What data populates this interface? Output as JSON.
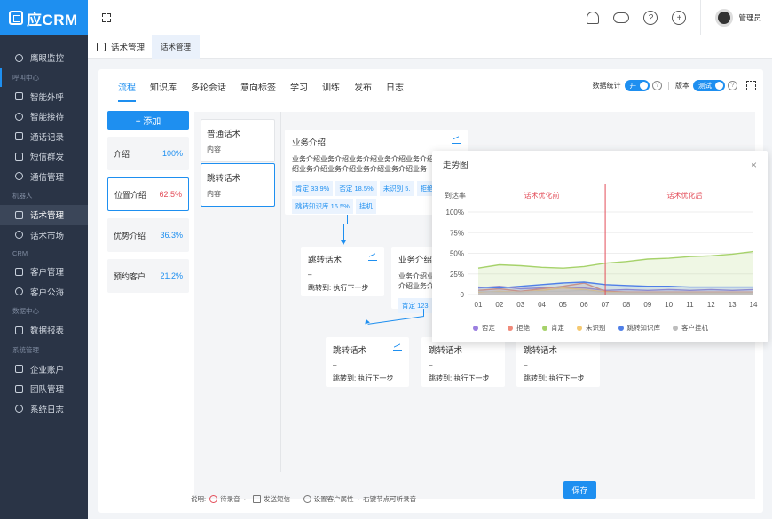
{
  "brand": {
    "logo_text": "应CRM"
  },
  "sidebar": {
    "items": [
      {
        "type": "item",
        "label": "鹰眼监控",
        "icon": "eye-icon"
      },
      {
        "type": "group",
        "label": "呼叫中心"
      },
      {
        "type": "item",
        "label": "智能外呼",
        "icon": "phone-icon"
      },
      {
        "type": "item",
        "label": "智能接待",
        "icon": "headset-icon"
      },
      {
        "type": "item",
        "label": "通话记录",
        "icon": "record-icon"
      },
      {
        "type": "item",
        "label": "短信群发",
        "icon": "mail-icon"
      },
      {
        "type": "item",
        "label": "通信管理",
        "icon": "signal-icon"
      },
      {
        "type": "group",
        "label": "机器人"
      },
      {
        "type": "item",
        "label": "话术管理",
        "icon": "script-icon",
        "active": true
      },
      {
        "type": "item",
        "label": "话术市场",
        "icon": "market-icon"
      },
      {
        "type": "group",
        "label": "CRM"
      },
      {
        "type": "item",
        "label": "客户管理",
        "icon": "customer-icon"
      },
      {
        "type": "item",
        "label": "客户公海",
        "icon": "pool-icon"
      },
      {
        "type": "group",
        "label": "数据中心"
      },
      {
        "type": "item",
        "label": "数据报表",
        "icon": "report-icon"
      },
      {
        "type": "group",
        "label": "系统管理"
      },
      {
        "type": "item",
        "label": "企业账户",
        "icon": "company-icon"
      },
      {
        "type": "item",
        "label": "团队管理",
        "icon": "team-icon"
      },
      {
        "type": "item",
        "label": "系统日志",
        "icon": "log-icon"
      }
    ]
  },
  "topbar": {
    "user_name": "管理员",
    "help": "?",
    "add": "+"
  },
  "breadcrumb": {
    "title": "话术管理",
    "tab": "话术管理"
  },
  "subtabs": [
    "流程",
    "知识库",
    "多轮会话",
    "意向标签",
    "学习",
    "训练",
    "发布",
    "日志"
  ],
  "tools": {
    "stats_label": "数据统计",
    "stats_toggle": "开",
    "version_label": "版本",
    "version_toggle": "测试",
    "help": "?"
  },
  "add_button": "+ 添加",
  "nodes": [
    {
      "name": "介绍",
      "pct": "100%"
    },
    {
      "name": "位置介绍",
      "pct": "62.5%",
      "active": true
    },
    {
      "name": "优势介绍",
      "pct": "36.3%"
    },
    {
      "name": "预约客户",
      "pct": "21.2%"
    }
  ],
  "palette": [
    {
      "title": "普通话术",
      "sub": "内容"
    },
    {
      "title": "跳转话术",
      "sub": "内容"
    }
  ],
  "main_card": {
    "title": "业务介绍",
    "body": "业务介绍业务介绍业务介绍业务介绍业务介绍业务介绍业务介绍业务介绍业务介绍业务介绍业务",
    "tags": [
      "肯定 33.9%",
      "否定 18.5%",
      "未识别 5.",
      "拒绝 13.3%",
      "跳转知识库 16.5%",
      "挂机"
    ]
  },
  "jump_cards": [
    {
      "title": "跳转话术",
      "dash": "–",
      "jump": "跳转到: 执行下一步"
    },
    {
      "title": "跳转话术",
      "dash": "–",
      "jump": "跳转到: 执行下一步"
    },
    {
      "title": "跳转话术",
      "dash": "–",
      "jump": "跳转到: 执行下一步"
    },
    {
      "title": "跳转话术",
      "dash": "–",
      "jump": "跳转到: 执行下一步"
    }
  ],
  "second_card": {
    "title": "业务介绍",
    "body": "业务介绍业务介绍业务介绍业务介",
    "tag": "肯定 123"
  },
  "footer": {
    "label": "说明:",
    "items": [
      "待录音",
      "发送短信",
      "设置客户属性",
      "右键节点可听录音"
    ],
    "save": "保存"
  },
  "popup": {
    "title": "走势图",
    "close": "×",
    "chart_data": {
      "type": "area",
      "ylabel": "到达率",
      "y_ticks": [
        "100%",
        "75%",
        "50%",
        "25%",
        "0"
      ],
      "ylim": [
        0,
        100
      ],
      "categories": [
        "01",
        "02",
        "03",
        "04",
        "05",
        "06",
        "07",
        "08",
        "09",
        "10",
        "11",
        "12",
        "13",
        "14"
      ],
      "divider_at": "07",
      "annotations": [
        "话术优化前",
        "话术优化后"
      ],
      "series": [
        {
          "name": "否定",
          "color": "#9b7fe0",
          "values": [
            8,
            10,
            7,
            8,
            9,
            8,
            5,
            6,
            5,
            6,
            5,
            6,
            5,
            6
          ]
        },
        {
          "name": "拒绝",
          "color": "#f08a7a",
          "values": [
            5,
            7,
            4,
            7,
            10,
            14,
            4,
            3,
            3,
            3,
            3,
            3,
            3,
            3
          ]
        },
        {
          "name": "肯定",
          "color": "#a6d26a",
          "values": [
            32,
            36,
            35,
            33,
            32,
            34,
            38,
            40,
            43,
            44,
            46,
            47,
            49,
            52
          ]
        },
        {
          "name": "未识别",
          "color": "#f5c971",
          "values": [
            3,
            4,
            3,
            5,
            8,
            6,
            3,
            2,
            2,
            2,
            2,
            2,
            2,
            2
          ]
        },
        {
          "name": "跳转知识库",
          "color": "#4f7fe8",
          "values": [
            9,
            8,
            10,
            12,
            14,
            15,
            12,
            11,
            10,
            10,
            9,
            9,
            9,
            9
          ]
        },
        {
          "name": "客户挂机",
          "color": "#bdbdbd",
          "values": [
            4,
            3,
            3,
            4,
            4,
            5,
            2,
            2,
            2,
            2,
            2,
            2,
            2,
            2
          ]
        }
      ]
    }
  }
}
